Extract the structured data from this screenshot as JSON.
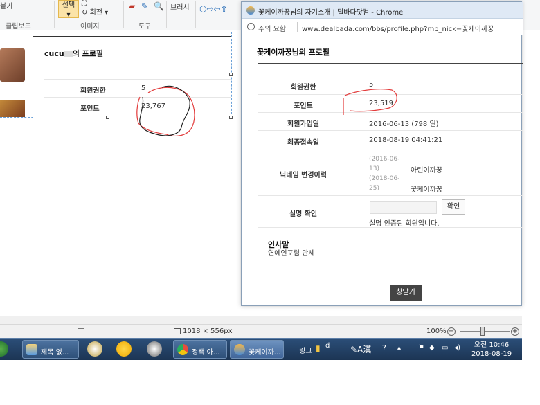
{
  "ribbon": {
    "paste_partial": "붙기",
    "select_label": "선택",
    "rotate_label": "회전",
    "brush_label": "브러시",
    "groups": {
      "clipboard": "클립보드",
      "image": "이미지",
      "tools": "도구"
    }
  },
  "background_page": {
    "title_prefix": "cucu",
    "title_suffix": "의 프로필",
    "rows": [
      {
        "label": "회원권한",
        "value": "5"
      },
      {
        "label": "포인트",
        "value": "23,767"
      }
    ]
  },
  "popup": {
    "window_title": "꽃케이까꿍님의 자기소개 | 딜바다닷컴 - Chrome",
    "security_warning": "주의 요함",
    "url": "www.dealbada.com/bbs/profile.php?mb_nick=꽃케이까꿍",
    "profile_title": "꽃케이까꿍님의 프로필",
    "rows": {
      "level": {
        "label": "회원권한",
        "value": "5"
      },
      "points": {
        "label": "포인트",
        "value": "23,519"
      },
      "joined": {
        "label": "회원가입일",
        "value": "2016-06-13 (798 일)"
      },
      "last_login": {
        "label": "최종접속일",
        "value": "2018-08-19 04:41:21"
      },
      "nick_history": {
        "label": "닉네임 변경이력",
        "entries": [
          {
            "date": "(2016-06-13)",
            "nick": "아린이까꿍"
          },
          {
            "date": "(2018-06-25)",
            "nick": "꽃케이까꿍"
          }
        ]
      },
      "verification": {
        "label": "실명 확인",
        "button": "확인",
        "message": "실명 인증된 회원입니다."
      }
    },
    "intro": {
      "title": "인사말",
      "text": "연예인포럼 만세"
    },
    "close_button": "창닫기"
  },
  "statusbar": {
    "dimensions": "1018 × 556px",
    "zoom": "100%"
  },
  "taskbar": {
    "items": [
      {
        "label": "제목 없..."
      },
      {
        "label": "정색 아..."
      },
      {
        "label": "꽃케이까..."
      }
    ],
    "link_label": "링크",
    "clock_time": "오전 10:46",
    "clock_date": "2018-08-19"
  }
}
